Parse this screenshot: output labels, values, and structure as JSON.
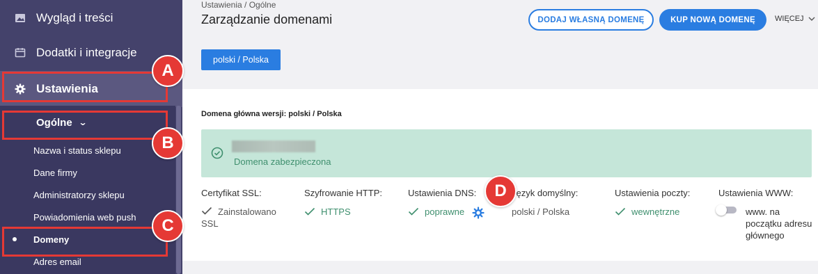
{
  "sidebar": {
    "main_items": [
      {
        "label": "Wygląd i treści",
        "icon": "image-icon"
      },
      {
        "label": "Dodatki i integracje",
        "icon": "calendar-icon"
      },
      {
        "label": "Ustawienia",
        "icon": "gear-icon"
      }
    ],
    "submenu_title": "Ogólne",
    "submenu_items": [
      {
        "label": "Nazwa i status sklepu"
      },
      {
        "label": "Dane firmy"
      },
      {
        "label": "Administratorzy sklepu"
      },
      {
        "label": "Powiadomienia web push"
      },
      {
        "label": "Domeny"
      },
      {
        "label": "Adres email"
      }
    ]
  },
  "callouts": {
    "a": "A",
    "b": "B",
    "c": "C",
    "d": "D"
  },
  "header": {
    "breadcrumb": "Ustawienia  /  Ogólne",
    "title": "Zarządzanie domenami",
    "add_domain_button": "DODAJ WŁASNĄ DOMENĘ",
    "buy_domain_button": "KUP NOWĄ DOMENĘ",
    "more_button": "WIĘCEJ"
  },
  "language_tab": "polski / Polska",
  "domain": {
    "heading": "Domena główna wersji: polski / Polska",
    "status": "Domena zabezpieczona"
  },
  "details": [
    {
      "label": "Certyfikat SSL:",
      "value": "Zainstalowano SSL"
    },
    {
      "label": "Szyfrowanie HTTP:",
      "value": "HTTPS"
    },
    {
      "label": "Ustawienia DNS:",
      "value": "poprawne"
    },
    {
      "label": "Język domyślny:",
      "value": "polski / Polska"
    },
    {
      "label": "Ustawienia poczty:",
      "value": "wewnętrzne"
    },
    {
      "label": "Ustawienia WWW:",
      "value": "www. na początku adresu głównego"
    }
  ],
  "colors": {
    "sidebar_bg": "#44426b",
    "accent_blue": "#2a7de1",
    "success_bg": "#c5e6d9",
    "success_text": "#3f8f6e",
    "callout_red": "#e53935"
  }
}
